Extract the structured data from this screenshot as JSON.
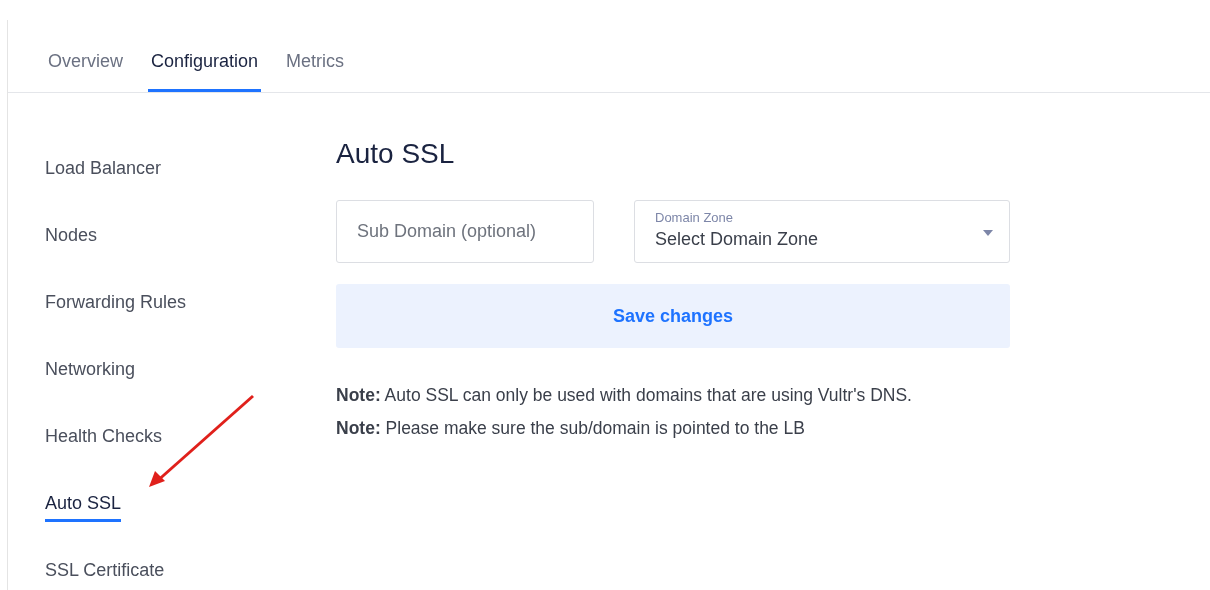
{
  "tabs": [
    {
      "label": "Overview",
      "selected": false
    },
    {
      "label": "Configuration",
      "selected": true
    },
    {
      "label": "Metrics",
      "selected": false
    }
  ],
  "sidebar": {
    "items": [
      {
        "label": "Load Balancer",
        "selected": false
      },
      {
        "label": "Nodes",
        "selected": false
      },
      {
        "label": "Forwarding Rules",
        "selected": false
      },
      {
        "label": "Networking",
        "selected": false
      },
      {
        "label": "Health Checks",
        "selected": false
      },
      {
        "label": "Auto SSL",
        "selected": true
      },
      {
        "label": "SSL Certificate",
        "selected": false
      }
    ]
  },
  "main": {
    "title": "Auto SSL",
    "sub_domain": {
      "placeholder": "Sub Domain (optional)"
    },
    "domain_zone": {
      "label": "Domain Zone",
      "value": "Select Domain Zone"
    },
    "save_button": "Save changes",
    "notes": [
      "**Note:** Auto SSL can only be used with domains that are using Vultr's DNS.",
      "**Note:** Please make sure the sub/domain is pointed to the LB"
    ]
  }
}
